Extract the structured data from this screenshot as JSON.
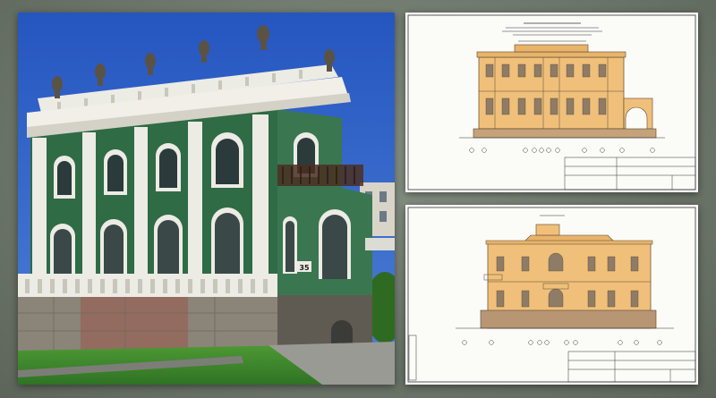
{
  "colors": {
    "sky": "#2f63c8",
    "facade_green": "#2f6b45",
    "facade_white": "#ecebe4",
    "stone": "#8b8478",
    "lawn": "#3c8a2c",
    "drawing_facade": "#f0c07a",
    "drawing_line": "#5a4630",
    "background": "#6f786d"
  },
  "photo": {
    "house_number": "35"
  },
  "drawings": {
    "top": {
      "facade": "elevation-with-side-terrace"
    },
    "bottom": {
      "facade": "elevation-with-balcony"
    }
  }
}
